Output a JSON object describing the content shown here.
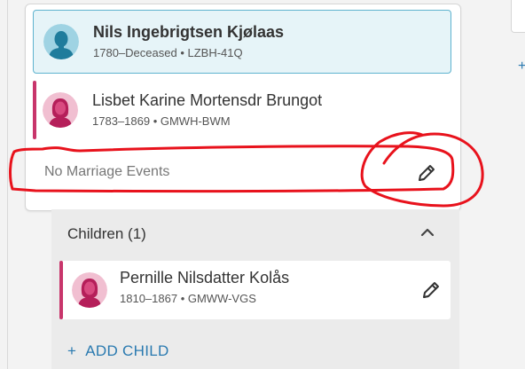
{
  "couple": {
    "husband": {
      "name": "Nils Ingebrigtsen Kjølaas",
      "dates": "1780–Deceased",
      "id": "LZBH-41Q",
      "sex": "male"
    },
    "wife": {
      "name": "Lisbet Karine Mortensdr Brungot",
      "dates": "1783–1869",
      "id": "GMWH-BWM",
      "sex": "female"
    }
  },
  "marriage": {
    "text": "No Marriage Events",
    "edit_icon": "pencil-icon"
  },
  "children_section": {
    "header": "Children (1)",
    "collapse_icon": "chevron-up-icon",
    "children": [
      {
        "name": "Pernille Nilsdatter Kolås",
        "dates": "1810–1867",
        "id": "GMWW-VGS",
        "sex": "female"
      }
    ],
    "add_child_plus": "+",
    "add_child_label": "ADD CHILD"
  },
  "colors": {
    "male_avatar": "#1f7c9c",
    "female_avatar": "#b51f5a",
    "female_bar": "#c8356b",
    "selected_border": "#5fb3cf",
    "selected_bg": "#e6f4f8",
    "link": "#2a7ab0",
    "annotation": "#e8121c"
  }
}
